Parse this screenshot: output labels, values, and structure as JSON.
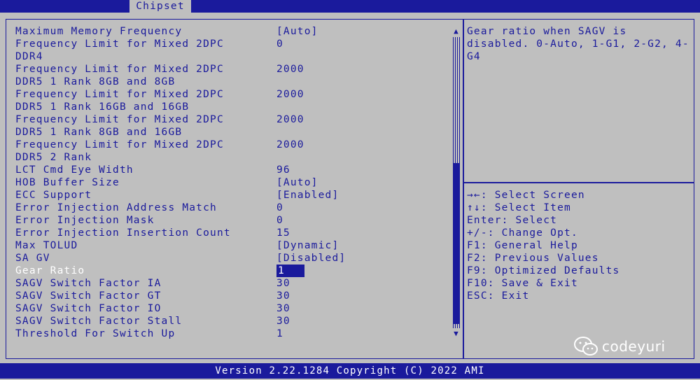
{
  "tabs": {
    "active": "Chipset"
  },
  "settings": [
    {
      "label": "Maximum Memory Frequency",
      "value": "[Auto]"
    },
    {
      "label": "Frequency Limit for Mixed 2DPC",
      "value": "0"
    },
    {
      "label": "DDR4",
      "value": ""
    },
    {
      "label": "Frequency Limit for Mixed 2DPC",
      "value": "2000"
    },
    {
      "label": "DDR5 1 Rank 8GB and 8GB",
      "value": ""
    },
    {
      "label": "Frequency Limit for Mixed 2DPC",
      "value": "2000"
    },
    {
      "label": "DDR5 1 Rank 16GB and 16GB",
      "value": ""
    },
    {
      "label": "Frequency Limit for Mixed 2DPC",
      "value": "2000"
    },
    {
      "label": "DDR5 1 Rank 8GB and 16GB",
      "value": ""
    },
    {
      "label": "Frequency Limit for Mixed 2DPC",
      "value": "2000"
    },
    {
      "label": "DDR5 2 Rank",
      "value": ""
    },
    {
      "label": "LCT Cmd Eye Width",
      "value": "96"
    },
    {
      "label": "HOB Buffer Size",
      "value": "[Auto]"
    },
    {
      "label": "ECC Support",
      "value": "[Enabled]"
    },
    {
      "label": "Error Injection Address Match",
      "value": "0"
    },
    {
      "label": "Error Injection Mask",
      "value": "0"
    },
    {
      "label": "Error Injection Insertion Count",
      "value": "15"
    },
    {
      "label": "Max TOLUD",
      "value": "[Dynamic]"
    },
    {
      "label": "SA GV",
      "value": "[Disabled]"
    },
    {
      "label": "Gear Ratio",
      "value": "1",
      "selected": true
    },
    {
      "label": "SAGV Switch Factor IA",
      "value": "30"
    },
    {
      "label": "SAGV Switch Factor GT",
      "value": "30"
    },
    {
      "label": "SAGV Switch Factor IO",
      "value": "30"
    },
    {
      "label": "SAGV Switch Factor Stall",
      "value": "30"
    },
    {
      "label": "Threshold For Switch Up",
      "value": "1"
    }
  ],
  "help_text": "Gear ratio when SAGV is disabled. 0-Auto, 1-G1, 2-G2, 4-G4",
  "key_help": [
    "→←: Select Screen",
    "↑↓: Select Item",
    "Enter: Select",
    "+/-: Change Opt.",
    "F1: General Help",
    "F2: Previous Values",
    "F9: Optimized Defaults",
    "F10: Save & Exit",
    "ESC: Exit"
  ],
  "footer": "Version 2.22.1284 Copyright (C) 2022 AMI",
  "watermark": {
    "text": "codeyuri",
    "icon": "wechat-icon"
  },
  "colors": {
    "accent": "#1a1a9c",
    "background": "#bfbfbf",
    "highlight_text": "#ffffff"
  }
}
